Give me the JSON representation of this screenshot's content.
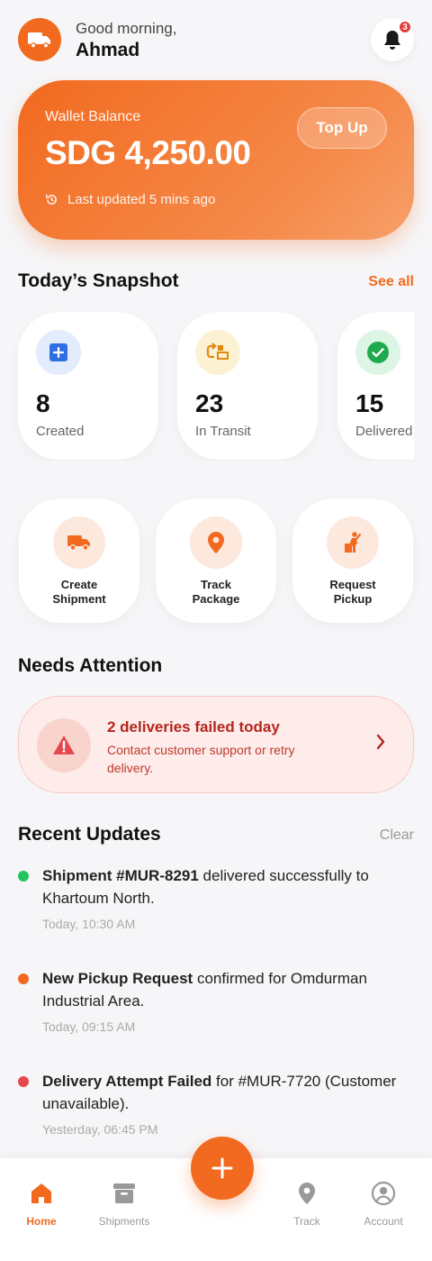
{
  "header": {
    "greeting": "Good morning,",
    "user_name": "Ahmad",
    "notification_count": "3"
  },
  "wallet": {
    "label": "Wallet Balance",
    "amount": "SDG 4,250.00",
    "updated": "Last updated 5 mins ago",
    "top_up_label": "Top Up"
  },
  "snapshot": {
    "title": "Today’s Snapshot",
    "see_all": "See all",
    "cards": [
      {
        "count": "8",
        "label": "Created",
        "icon": "plus-square-icon",
        "bg": "#e3ecfd",
        "fg": "#2f6fe4"
      },
      {
        "count": "23",
        "label": "In Transit",
        "icon": "transit-icon",
        "bg": "#fdf1d4",
        "fg": "#e08a0b"
      },
      {
        "count": "15",
        "label": "Delivered",
        "icon": "check-circle-icon",
        "bg": "#dcf5e4",
        "fg": "#1faa4f"
      }
    ]
  },
  "actions": [
    {
      "label": "Create\nShipment",
      "icon": "truck-icon"
    },
    {
      "label": "Track\nPackage",
      "icon": "location-pin-icon"
    },
    {
      "label": "Request\nPickup",
      "icon": "person-pickup-icon"
    }
  ],
  "attention": {
    "title": "Needs Attention",
    "alert_title": "2 deliveries failed today",
    "alert_body": "Contact customer support or retry delivery."
  },
  "updates": {
    "title": "Recent Updates",
    "clear": "Clear",
    "items": [
      {
        "bold": "Shipment #MUR-8291",
        "rest": " delivered successfully to Khartoum North.",
        "time": "Today, 10:30 AM",
        "color": "#22c55e"
      },
      {
        "bold": "New Pickup Request",
        "rest": " confirmed for Omdurman Industrial Area.",
        "time": "Today, 09:15 AM",
        "color": "#f26a1f"
      },
      {
        "bold": "Delivery Attempt Failed",
        "rest": " for #MUR-7720 (Customer unavailable).",
        "time": "Yesterday, 06:45 PM",
        "color": "#e5484d"
      }
    ]
  },
  "nav": {
    "home": "Home",
    "shipments": "Shipments",
    "track": "Track",
    "account": "Account"
  },
  "colors": {
    "accent": "#f26a1f",
    "danger": "#b3261e"
  }
}
